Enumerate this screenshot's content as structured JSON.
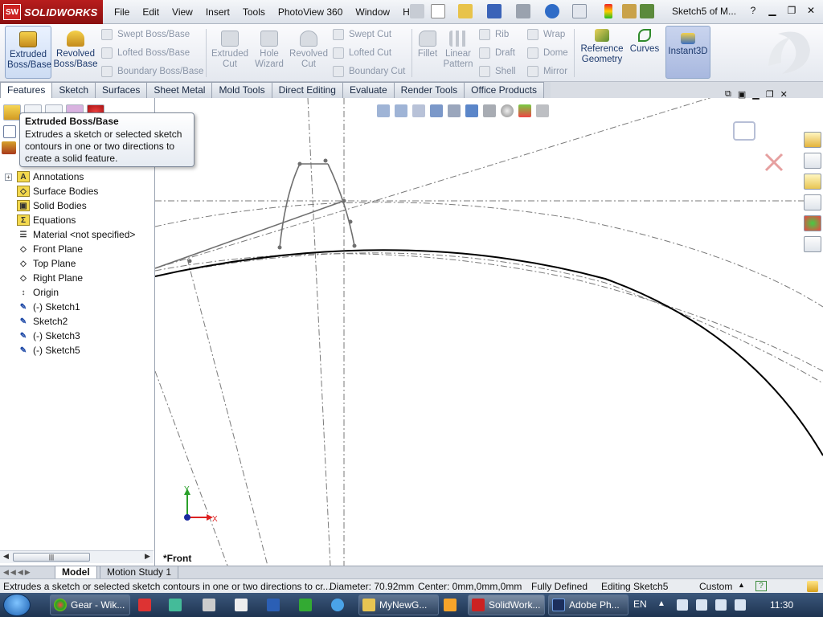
{
  "app": {
    "name": "SOLIDWORKS",
    "ds": "SW",
    "doc_title": "Sketch5 of M..."
  },
  "menus": [
    "File",
    "Edit",
    "View",
    "Insert",
    "Tools",
    "PhotoView 360",
    "Window",
    "Help"
  ],
  "command_manager": {
    "extruded_boss": "Extruded Boss/Base",
    "revolved_boss": "Revolved Boss/Base",
    "swept_boss": "Swept Boss/Base",
    "lofted_boss": "Lofted Boss/Base",
    "boundary_boss": "Boundary Boss/Base",
    "extruded_cut": "Extruded Cut",
    "hole_wizard": "Hole Wizard",
    "revolved_cut": "Revolved Cut",
    "swept_cut": "Swept Cut",
    "lofted_cut": "Lofted Cut",
    "boundary_cut": "Boundary Cut",
    "fillet": "Fillet",
    "linear_pattern": "Linear Pattern",
    "rib": "Rib",
    "draft": "Draft",
    "shell": "Shell",
    "wrap": "Wrap",
    "dome": "Dome",
    "mirror": "Mirror",
    "reference_geometry": "Reference Geometry",
    "curves": "Curves",
    "instant3d": "Instant3D"
  },
  "tabs": [
    "Features",
    "Sketch",
    "Surfaces",
    "Sheet Metal",
    "Mold Tools",
    "Direct Editing",
    "Evaluate",
    "Render Tools",
    "Office Products"
  ],
  "tooltip": {
    "title": "Extruded Boss/Base",
    "desc_line1": "Extrudes a sketch or selected sketch",
    "desc_line2": "contours in one or two directions to",
    "desc_line3": "create a solid feature."
  },
  "tree": [
    {
      "label": "Annotations",
      "icon": "annotations-icon",
      "expand": true,
      "glyph": "A"
    },
    {
      "label": "Surface Bodies",
      "icon": "surface-bodies-icon",
      "expand": false,
      "glyph": "◇"
    },
    {
      "label": "Solid Bodies",
      "icon": "solid-bodies-icon",
      "expand": false,
      "glyph": "▣"
    },
    {
      "label": "Equations",
      "icon": "equations-icon",
      "expand": false,
      "glyph": "Σ"
    },
    {
      "label": "Material <not specified>",
      "icon": "material-icon",
      "expand": false,
      "glyph": "☰"
    },
    {
      "label": "Front Plane",
      "icon": "plane-icon",
      "expand": false,
      "glyph": "◇"
    },
    {
      "label": "Top Plane",
      "icon": "plane-icon",
      "expand": false,
      "glyph": "◇"
    },
    {
      "label": "Right Plane",
      "icon": "plane-icon",
      "expand": false,
      "glyph": "◇"
    },
    {
      "label": "Origin",
      "icon": "origin-icon",
      "expand": false,
      "glyph": "↕"
    },
    {
      "label": "(-) Sketch1",
      "icon": "sketch-icon",
      "expand": false,
      "glyph": "✎"
    },
    {
      "label": "Sketch2",
      "icon": "sketch-icon",
      "expand": false,
      "glyph": "✎"
    },
    {
      "label": "(-) Sketch3",
      "icon": "sketch-icon",
      "expand": false,
      "glyph": "✎"
    },
    {
      "label": "(-) Sketch5",
      "icon": "sketch-icon",
      "expand": false,
      "glyph": "✎"
    }
  ],
  "graphics": {
    "view_name": "*Front",
    "axis_x": "X",
    "axis_y": "Y"
  },
  "bottom_tabs": {
    "model": "Model",
    "motion": "Motion Study 1"
  },
  "status": {
    "hint": "Extrudes a sketch or selected sketch contours in one or two directions to cr...",
    "diameter": "Diameter: 70.92mm",
    "center": "Center: 0mm,0mm,0mm",
    "defined": "Fully Defined",
    "editing": "Editing Sketch5",
    "units": "Custom"
  },
  "taskbar": {
    "items": [
      "Gear - Wik...",
      "MyNewG...",
      "SolidWork...",
      "Adobe Ph..."
    ],
    "lang": "EN",
    "time": "11:30"
  }
}
